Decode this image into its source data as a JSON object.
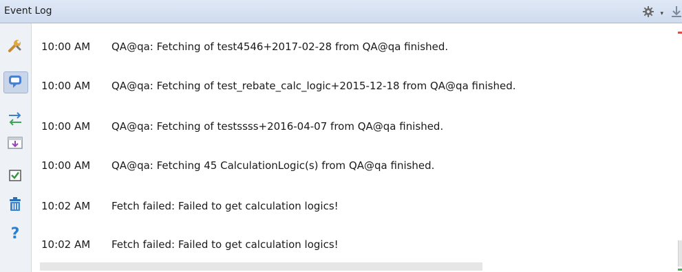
{
  "window": {
    "title": "Event Log"
  },
  "toolbar": {
    "tools": [
      {
        "icon": "wrench-icon"
      },
      {
        "icon": "speech-bubble-icon"
      },
      {
        "icon": "sync-arrows-icon"
      },
      {
        "icon": "import-icon"
      },
      {
        "icon": "checkbox-icon"
      },
      {
        "icon": "trash-icon"
      },
      {
        "icon": "help-icon",
        "label": "?"
      }
    ]
  },
  "log": {
    "entries": [
      {
        "time": "10:00 AM",
        "message": "QA@qa: Fetching of test4546+2017-02-28 from QA@qa finished."
      },
      {
        "time": "10:00 AM",
        "message": "QA@qa: Fetching of test_rebate_calc_logic+2015-12-18 from QA@qa finished."
      },
      {
        "time": "10:00 AM",
        "message": "QA@qa: Fetching of testssss+2016-04-07 from QA@qa finished."
      },
      {
        "time": "10:00 AM",
        "message": "QA@qa: Fetching 45 CalculationLogic(s) from QA@qa finished."
      },
      {
        "time": "10:02 AM",
        "message": "Fetch failed: Failed to get calculation logics!"
      },
      {
        "time": "10:02 AM",
        "message": "Fetch failed: Failed to get calculation logics!"
      }
    ]
  },
  "colors": {
    "title_bar": "#d6e1f1",
    "toolbar_bg": "#eef1f6",
    "error_marker": "#e34a4a",
    "ok_marker": "#3bbf4a"
  }
}
